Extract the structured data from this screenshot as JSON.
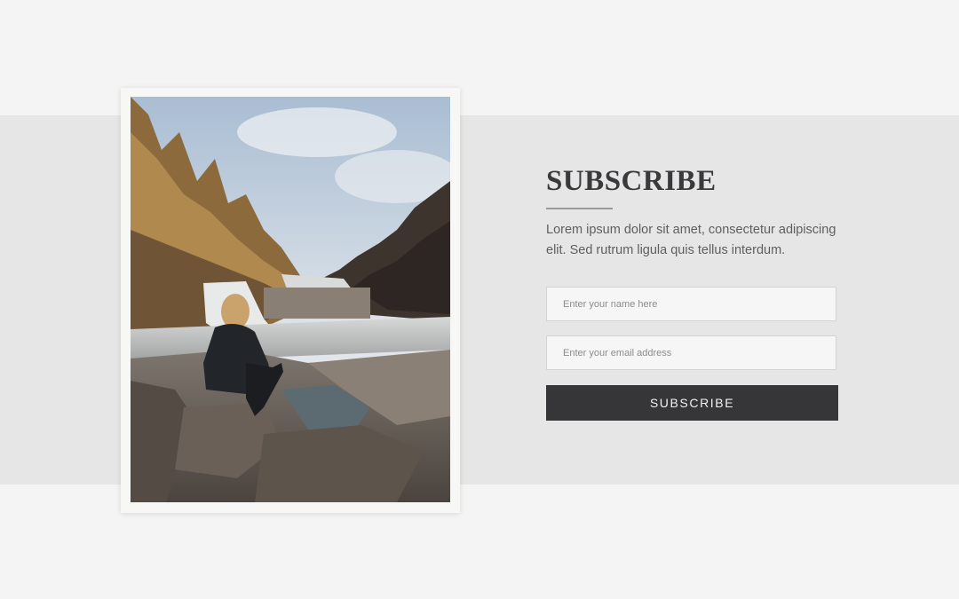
{
  "subscribe": {
    "title": "SUBSCRIBE",
    "description": "Lorem ipsum dolor sit amet, consectetur adipiscing elit. Sed rutrum ligula quis tellus interdum.",
    "name_placeholder": "Enter your name here",
    "email_placeholder": "Enter your email address",
    "button_label": "SUBSCRIBE"
  },
  "colors": {
    "page_background": "#f4f4f4",
    "band_background": "#e7e6e7",
    "button_background": "#363538",
    "title_text": "#3a3a3c"
  },
  "image": {
    "subject": "woman-sitting-by-waterfall-photo"
  }
}
